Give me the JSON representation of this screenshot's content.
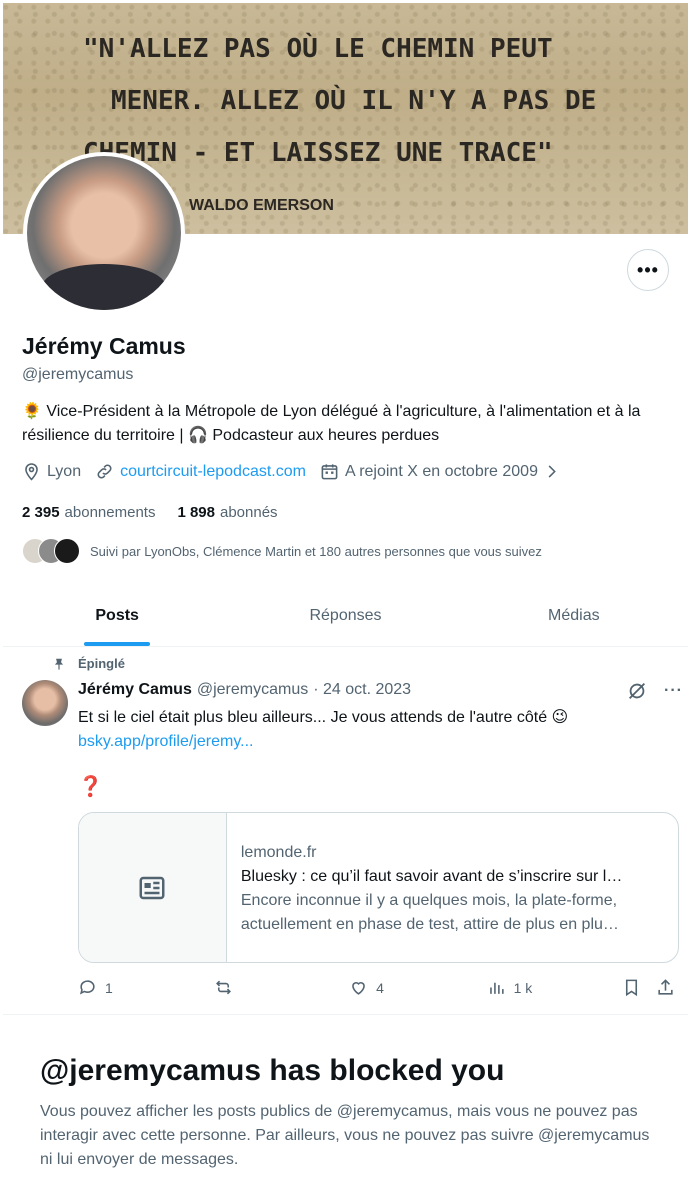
{
  "banner": {
    "quote_line1": "\"N'ALLEZ PAS OÙ LE CHEMIN PEUT",
    "quote_line2": "MENER. ALLEZ OÙ IL N'Y A PAS DE",
    "quote_line3": "CHEMIN - ET LAISSEZ UNE TRACE\"",
    "author": "WALDO EMERSON"
  },
  "profile": {
    "name": "Jérémy Camus",
    "handle": "@jeremycamus",
    "bio": "🌻 Vice-Président à la Métropole de Lyon délégué à l'agriculture, à l'alimentation et à la résilience du territoire | 🎧 Podcasteur aux heures perdues",
    "location": "Lyon",
    "website": "courtcircuit-lepodcast.com",
    "joined": "A rejoint X en octobre 2009",
    "following_count": "2 395",
    "following_label": "abonnements",
    "followers_count": "1 898",
    "followers_label": "abonnés",
    "followed_by": "Suivi par LyonObs, Clémence Martin et 180 autres personnes que vous suivez"
  },
  "tabs": [
    {
      "label": "Posts",
      "active": true
    },
    {
      "label": "Réponses",
      "active": false
    },
    {
      "label": "Médias",
      "active": false
    }
  ],
  "post": {
    "pinned_label": "Épinglé",
    "author": "Jérémy Camus",
    "handle": "@jeremycamus",
    "date": "· 24 oct. 2023",
    "text": "Et si le ciel était plus bleu ailleurs... Je vous attends de l'autre côté 😉",
    "link": "bsky.app/profile/jeremy...",
    "question_mark": "❓",
    "card": {
      "domain": "lemonde.fr",
      "title": "Bluesky : ce qu’il faut savoir avant de s’inscrire sur l…",
      "description": "Encore inconnue il y a quelques mois, la plate-forme, actuellement en phase de test, attire de plus en plu…"
    },
    "replies": "1",
    "reposts": "",
    "likes": "4",
    "views": "1 k"
  },
  "blocked": {
    "title": "@jeremycamus has blocked you",
    "text": "Vous pouvez afficher les posts publics de @jeremycamus, mais vous ne pouvez pas interagir avec cette personne. Par ailleurs, vous ne pouvez pas suivre @jeremycamus ni lui envoyer de messages."
  },
  "colors": {
    "accent": "#1d9bf0",
    "text_primary": "#0f1419",
    "text_secondary": "#536471",
    "border": "#cfd9de"
  }
}
